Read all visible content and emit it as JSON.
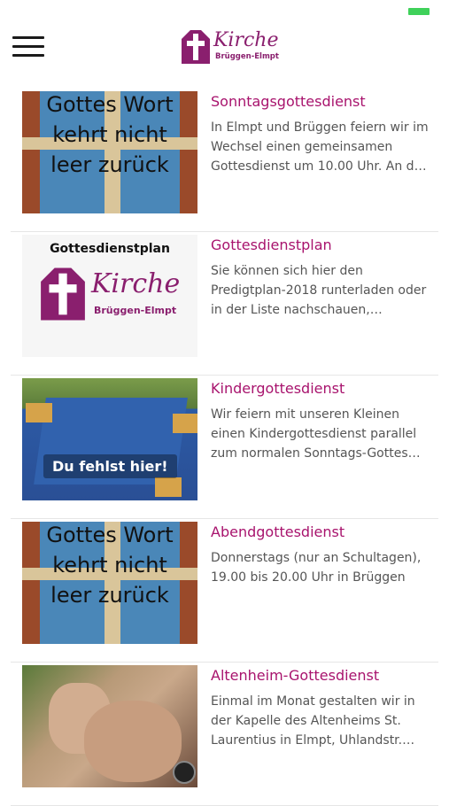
{
  "header": {
    "logo": {
      "title": "Kirche",
      "subtitle": "Brüggen-Elmpt"
    }
  },
  "items": [
    {
      "title": "Sonntagsgottesdienst",
      "description": "In Elmpt und Brüggen feiern wir im Wechsel einen gemeinsamen Gottesdienst um 10.00 Uhr. An d…",
      "image_text": [
        "Gottes Wort",
        "kehrt nicht",
        "leer zurück"
      ]
    },
    {
      "title": "Gottesdienstplan",
      "description": "Sie können sich hier den Predigtplan-2018 runterladen oder in der Liste nachschauen,…",
      "image_text": {
        "heading": "Gottesdienstplan",
        "logo": "Kirche",
        "sub": "Brüggen-Elmpt"
      }
    },
    {
      "title": "Kindergottesdienst",
      "description": "Wir feiern mit unseren Kleinen einen Kindergottesdienst parallel zum normalen Sonntags-Gottes…",
      "image_text": "Du fehlst hier!"
    },
    {
      "title": "Abendgottesdienst",
      "description": "Donnerstags (nur an Schultagen), 19.00 bis 20.00 Uhr in Brüggen",
      "image_text": [
        "Gottes Wort",
        "kehrt nicht",
        "leer zurück"
      ]
    },
    {
      "title": "Altenheim-Gottesdienst",
      "description": "Einmal im Monat gestalten wir in der Kapelle des Altenheims St. Laurentius in Elmpt, Uhlandstr.…"
    }
  ],
  "colors": {
    "accent": "#a8136d",
    "logo": "#8a1f6e",
    "battery": "#3fd15a"
  }
}
